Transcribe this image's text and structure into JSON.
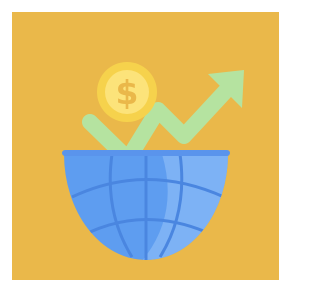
{
  "icon": {
    "name": "global-investment-growth-icon",
    "parts": [
      "dollar-coin-icon",
      "growth-arrow-icon",
      "half-globe-icon"
    ],
    "coin_symbol": "$"
  },
  "colors": {
    "background": "#EAB84A",
    "page": "#FFFFFF",
    "coin_outer": "#F6D24C",
    "coin_inner": "#FCE37A",
    "coin_symbol": "#EAB84A",
    "arrow": "#B5E3A0",
    "globe_dark": "#5E9DF0",
    "globe_light": "#7DB2F5",
    "globe_lines": "#4A86E0",
    "globe_top": "#5A94EC"
  }
}
